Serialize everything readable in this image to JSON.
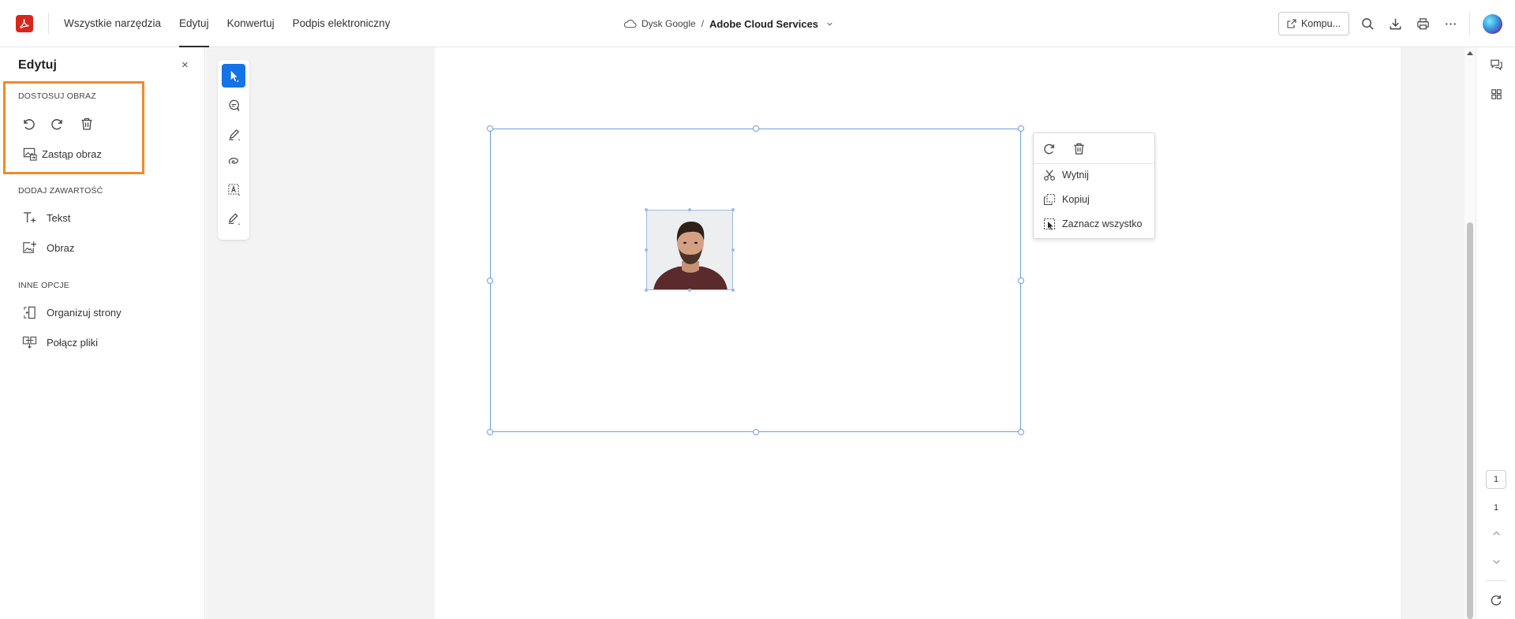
{
  "app": {
    "name": "Adobe Acrobat"
  },
  "nav": {
    "items": [
      {
        "label": "Wszystkie narzędzia",
        "active": false
      },
      {
        "label": "Edytuj",
        "active": true
      },
      {
        "label": "Konwertuj",
        "active": false
      },
      {
        "label": "Podpis elektroniczny",
        "active": false
      }
    ]
  },
  "breadcrumb": {
    "location": "Dysk Google",
    "separator": "/",
    "file": "Adobe Cloud Services"
  },
  "toolbar": {
    "share_label": "Kompu..."
  },
  "left_panel": {
    "title": "Edytuj",
    "close_label": "×",
    "section_adjust": "DOSTOSUJ OBRAZ",
    "replace_image": "Zastąp obraz",
    "section_add": "DODAJ ZAWARTOŚĆ",
    "text": "Tekst",
    "image": "Obraz",
    "section_other": "INNE OPCJE",
    "organize_pages": "Organizuj strony",
    "combine_files": "Połącz pliki"
  },
  "context_menu": {
    "cut": "Wytnij",
    "copy": "Kopiuj",
    "select_all": "Zaznacz wszystko"
  },
  "pager": {
    "current": "1",
    "total": "1"
  },
  "colors": {
    "accent": "#1473e6",
    "brand": "#d9261c",
    "highlight": "#f08a2c",
    "selection": "#6d9fe0"
  }
}
